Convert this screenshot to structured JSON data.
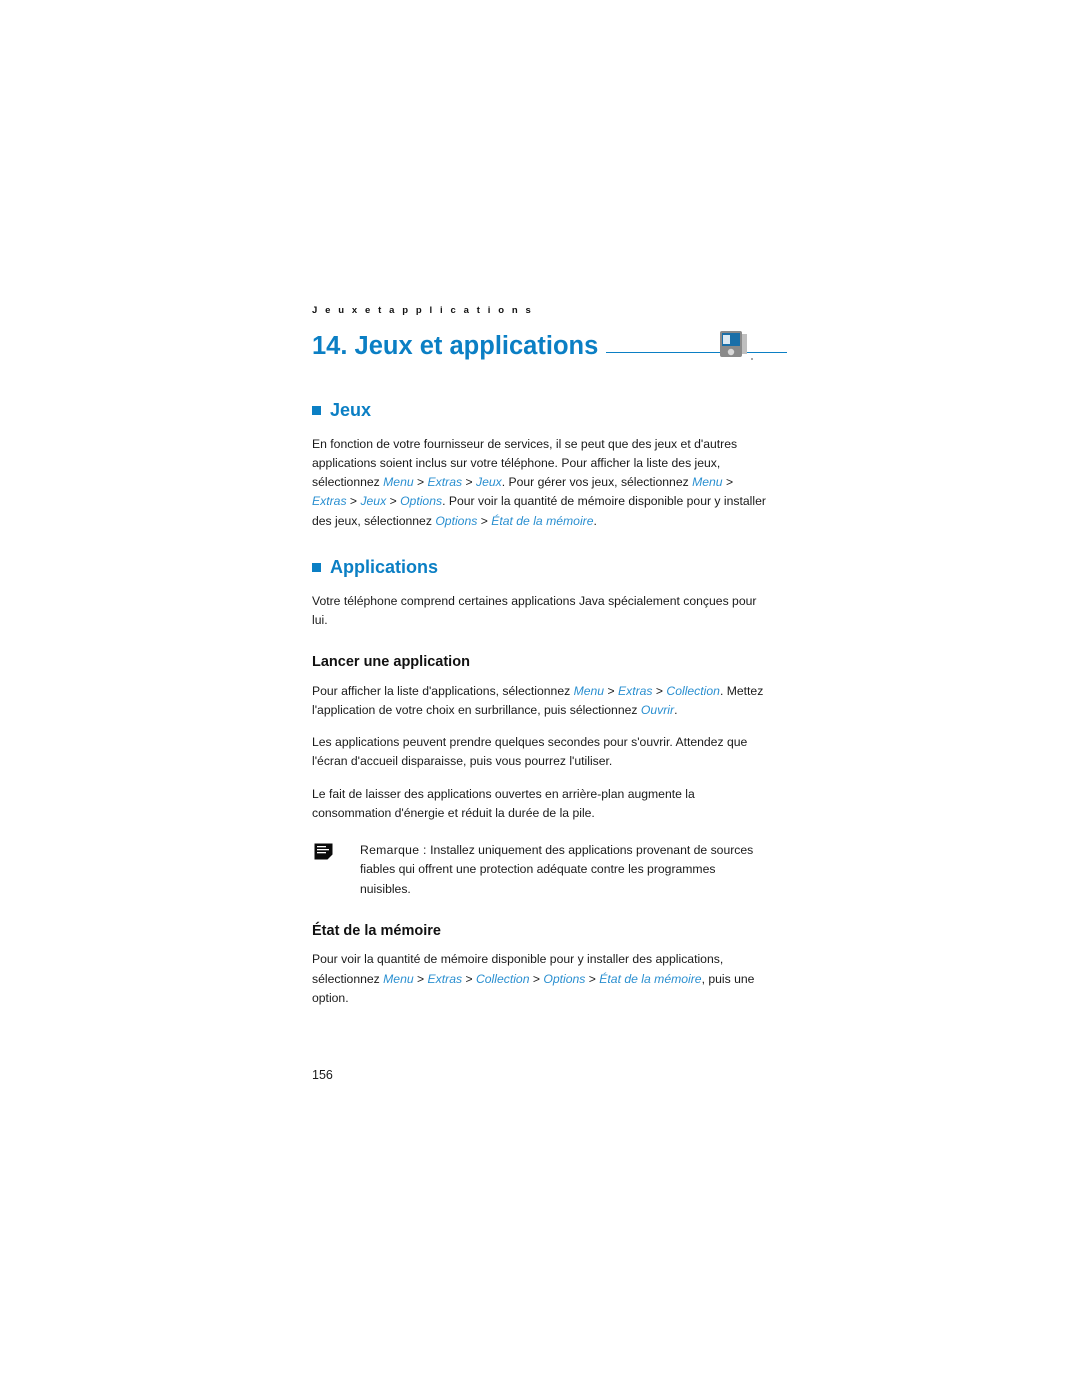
{
  "document": {
    "running_header": "J e u x   e t   a p p l i c a t i o n s",
    "chapter_title": "14. Jeux et applications",
    "page_number": "156",
    "accent_color": "#0b7fc4",
    "nav_color": "#2a8fd0",
    "icons": {
      "chapter": "phone-device-icon",
      "note": "note-page-icon"
    }
  },
  "sections": {
    "jeux": {
      "heading": "Jeux",
      "paragraph_parts": [
        {
          "text": "En fonction de votre fournisseur de services, il se peut que des jeux et d'autres applications soient inclus sur votre téléphone. Pour afficher la liste des jeux, sélectionnez ",
          "style": "normal"
        },
        {
          "text": "Menu",
          "style": "nav"
        },
        {
          "text": " > ",
          "style": "normal"
        },
        {
          "text": "Extras",
          "style": "nav"
        },
        {
          "text": " > ",
          "style": "normal"
        },
        {
          "text": "Jeux",
          "style": "nav"
        },
        {
          "text": ". Pour gérer vos jeux, sélectionnez ",
          "style": "normal"
        },
        {
          "text": "Menu",
          "style": "nav"
        },
        {
          "text": " > ",
          "style": "normal"
        },
        {
          "text": "Extras",
          "style": "nav"
        },
        {
          "text": " > ",
          "style": "normal"
        },
        {
          "text": "Jeux",
          "style": "nav"
        },
        {
          "text": " > ",
          "style": "normal"
        },
        {
          "text": "Options",
          "style": "nav"
        },
        {
          "text": ". Pour voir la quantité de mémoire disponible pour y installer des jeux, sélectionnez ",
          "style": "normal"
        },
        {
          "text": "Options",
          "style": "nav"
        },
        {
          "text": " > ",
          "style": "normal"
        },
        {
          "text": "État de la mémoire",
          "style": "nav"
        },
        {
          "text": ".",
          "style": "normal"
        }
      ]
    },
    "applications": {
      "heading": "Applications",
      "intro": "Votre téléphone comprend certaines applications Java spécialement conçues pour lui.",
      "lancer": {
        "heading": "Lancer une application",
        "paragraph1_parts": [
          {
            "text": "Pour afficher la liste d'applications, sélectionnez ",
            "style": "normal"
          },
          {
            "text": "Menu",
            "style": "nav"
          },
          {
            "text": " > ",
            "style": "normal"
          },
          {
            "text": "Extras",
            "style": "nav"
          },
          {
            "text": " > ",
            "style": "normal"
          },
          {
            "text": "Collection",
            "style": "nav"
          },
          {
            "text": ". Mettez l'application de votre choix en surbrillance, puis sélectionnez ",
            "style": "normal"
          },
          {
            "text": "Ouvrir",
            "style": "nav"
          },
          {
            "text": ".",
            "style": "normal"
          }
        ],
        "paragraph2": "Les applications peuvent prendre quelques secondes pour s'ouvrir. Attendez que l'écran d'accueil disparaisse, puis vous pourrez l'utiliser.",
        "paragraph3": "Le fait de laisser des applications ouvertes en arrière-plan augmente la consommation d'énergie et réduit la durée de la pile.",
        "note": {
          "label": "Remarque :",
          "text": " Installez uniquement des applications provenant de sources fiables qui offrent une protection adéquate contre les programmes nuisibles."
        }
      },
      "memoire": {
        "heading": "État de la mémoire",
        "paragraph_parts": [
          {
            "text": "Pour voir la quantité de mémoire disponible pour y installer des applications, sélectionnez ",
            "style": "normal"
          },
          {
            "text": "Menu",
            "style": "nav"
          },
          {
            "text": " > ",
            "style": "normal"
          },
          {
            "text": "Extras",
            "style": "nav"
          },
          {
            "text": " > ",
            "style": "normal"
          },
          {
            "text": "Collection",
            "style": "nav"
          },
          {
            "text": " > ",
            "style": "normal"
          },
          {
            "text": "Options",
            "style": "nav"
          },
          {
            "text": " > ",
            "style": "normal"
          },
          {
            "text": "État de la mémoire",
            "style": "nav"
          },
          {
            "text": ", puis une option.",
            "style": "normal"
          }
        ]
      }
    }
  }
}
